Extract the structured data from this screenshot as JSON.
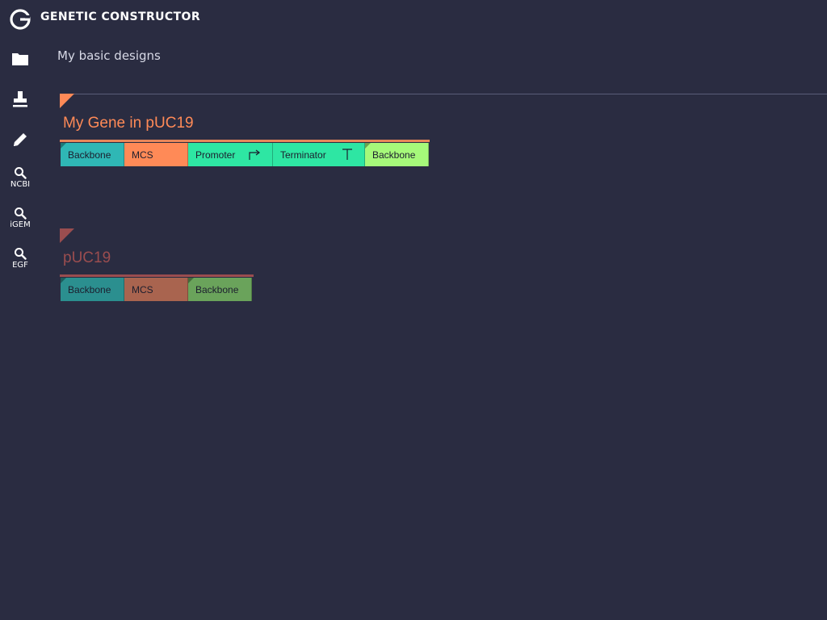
{
  "app": {
    "title": "GENETIC CONSTRUCTOR"
  },
  "sidebar": {
    "items": [
      {
        "icon": "folder-icon",
        "label": ""
      },
      {
        "icon": "stamp-icon",
        "label": ""
      },
      {
        "icon": "pencil-icon",
        "label": ""
      },
      {
        "icon": "search-icon",
        "label": "NCBI"
      },
      {
        "icon": "search-icon",
        "label": "iGEM"
      },
      {
        "icon": "search-icon",
        "label": "EGF"
      }
    ]
  },
  "project": {
    "title": "My basic designs"
  },
  "constructs": [
    {
      "title": "My Gene in pUC19",
      "color": "#e8875a",
      "blocks": [
        {
          "label": "Backbone",
          "color": "#2fb7b5",
          "glyph": ""
        },
        {
          "label": "MCS",
          "color": "#ff8a57",
          "glyph": ""
        },
        {
          "label": "Promoter",
          "color": "#2ee6a3",
          "glyph": "promoter-icon"
        },
        {
          "label": "Terminator",
          "color": "#2ee6a3",
          "glyph": "terminator-icon"
        },
        {
          "label": "Backbone",
          "color": "#a6f97a",
          "glyph": ""
        }
      ]
    },
    {
      "title": "pUC19",
      "color": "#9a4d4f",
      "blocks": [
        {
          "label": "Backbone",
          "color": "#2b8f8f",
          "glyph": ""
        },
        {
          "label": "MCS",
          "color": "#a9644f",
          "glyph": ""
        },
        {
          "label": "Backbone",
          "color": "#6aa35b",
          "glyph": ""
        }
      ]
    }
  ]
}
